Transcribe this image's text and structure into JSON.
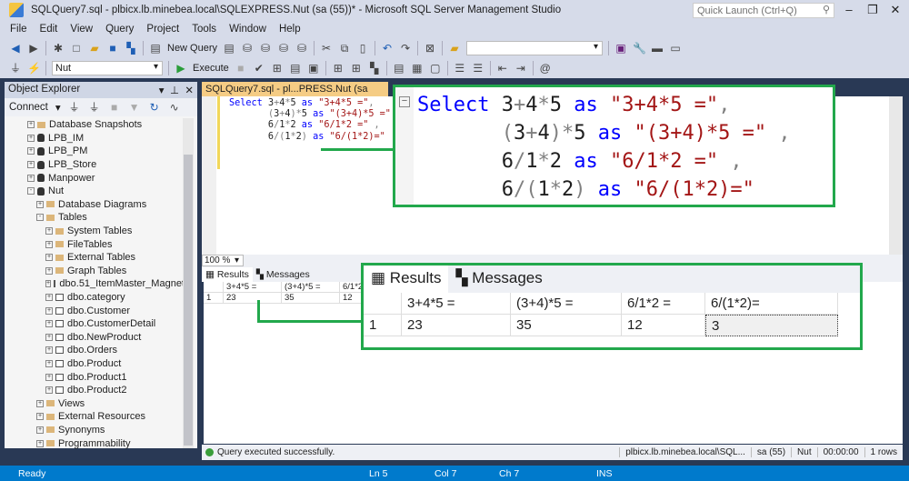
{
  "window": {
    "title": "SQLQuery7.sql - plbicx.lb.minebea.local\\SQLEXPRESS.Nut (sa (55))* - Microsoft SQL Server Management Studio",
    "quick_launch_placeholder": "Quick Launch (Ctrl+Q)"
  },
  "menu": [
    "File",
    "Edit",
    "View",
    "Query",
    "Project",
    "Tools",
    "Window",
    "Help"
  ],
  "toolbar": {
    "new_query": "New Query",
    "database": "Nut",
    "execute": "Execute"
  },
  "object_explorer": {
    "title": "Object Explorer",
    "connect": "Connect",
    "items": [
      {
        "label": "Database Snapshots",
        "level": 1,
        "icon": "folder",
        "exp": "+"
      },
      {
        "label": "LPB_IM",
        "level": 1,
        "icon": "db",
        "exp": "+"
      },
      {
        "label": "LPB_PM",
        "level": 1,
        "icon": "db",
        "exp": "+"
      },
      {
        "label": "LPB_Store",
        "level": 1,
        "icon": "db",
        "exp": "+"
      },
      {
        "label": "Manpower",
        "level": 1,
        "icon": "db",
        "exp": "+"
      },
      {
        "label": "Nut",
        "level": 1,
        "icon": "db",
        "exp": "-"
      },
      {
        "label": "Database Diagrams",
        "level": 2,
        "icon": "folder",
        "exp": "+"
      },
      {
        "label": "Tables",
        "level": 2,
        "icon": "folder",
        "exp": "-"
      },
      {
        "label": "System Tables",
        "level": 3,
        "icon": "folder",
        "exp": "+"
      },
      {
        "label": "FileTables",
        "level": 3,
        "icon": "folder",
        "exp": "+"
      },
      {
        "label": "External Tables",
        "level": 3,
        "icon": "folder",
        "exp": "+"
      },
      {
        "label": "Graph Tables",
        "level": 3,
        "icon": "folder",
        "exp": "+"
      },
      {
        "label": "dbo.51_ItemMaster_Magnet",
        "level": 3,
        "icon": "table",
        "exp": "+"
      },
      {
        "label": "dbo.category",
        "level": 3,
        "icon": "table",
        "exp": "+"
      },
      {
        "label": "dbo.Customer",
        "level": 3,
        "icon": "table",
        "exp": "+"
      },
      {
        "label": "dbo.CustomerDetail",
        "level": 3,
        "icon": "table",
        "exp": "+"
      },
      {
        "label": "dbo.NewProduct",
        "level": 3,
        "icon": "table",
        "exp": "+"
      },
      {
        "label": "dbo.Orders",
        "level": 3,
        "icon": "table",
        "exp": "+"
      },
      {
        "label": "dbo.Product",
        "level": 3,
        "icon": "table",
        "exp": "+"
      },
      {
        "label": "dbo.Product1",
        "level": 3,
        "icon": "table",
        "exp": "+"
      },
      {
        "label": "dbo.Product2",
        "level": 3,
        "icon": "table",
        "exp": "+"
      },
      {
        "label": "Views",
        "level": 2,
        "icon": "folder",
        "exp": "+"
      },
      {
        "label": "External Resources",
        "level": 2,
        "icon": "folder",
        "exp": "+"
      },
      {
        "label": "Synonyms",
        "level": 2,
        "icon": "folder",
        "exp": "+"
      },
      {
        "label": "Programmability",
        "level": 2,
        "icon": "folder",
        "exp": "+"
      }
    ]
  },
  "editor": {
    "tab": "SQLQuery7.sql - pl...PRESS.Nut (sa (55))*",
    "zoom": "100 %",
    "lines": [
      [
        [
          "kw",
          "Select "
        ],
        [
          "",
          "3"
        ],
        [
          "op",
          "+"
        ],
        [
          "",
          "4"
        ],
        [
          "op",
          "*"
        ],
        [
          "",
          "5 "
        ],
        [
          "kw",
          "as "
        ],
        [
          "st",
          "\"3+4*5 =\""
        ],
        [
          "op",
          ","
        ]
      ],
      [
        [
          "",
          "       "
        ],
        [
          "op",
          "("
        ],
        [
          "",
          "3"
        ],
        [
          "op",
          "+"
        ],
        [
          "",
          "4"
        ],
        [
          "op",
          ")*"
        ],
        [
          "",
          "5 "
        ],
        [
          "kw",
          "as "
        ],
        [
          "st",
          "\"(3+4)*5 =\""
        ],
        [
          "op",
          " ,"
        ]
      ],
      [
        [
          "",
          "       6"
        ],
        [
          "op",
          "/"
        ],
        [
          "",
          "1"
        ],
        [
          "op",
          "*"
        ],
        [
          "",
          "2 "
        ],
        [
          "kw",
          "as "
        ],
        [
          "st",
          "\"6/1*2 =\""
        ],
        [
          "op",
          " ,"
        ]
      ],
      [
        [
          "",
          "       6"
        ],
        [
          "op",
          "/("
        ],
        [
          "",
          "1"
        ],
        [
          "op",
          "*"
        ],
        [
          "",
          "2"
        ],
        [
          "op",
          ") "
        ],
        [
          "kw",
          "as "
        ],
        [
          "st",
          "\"6/(1*2)=\""
        ]
      ]
    ]
  },
  "results": {
    "tabs": [
      "Results",
      "Messages"
    ],
    "columns": [
      "3+4*5 =",
      "(3+4)*5 =",
      "6/1*2 =",
      "6/(1*2)="
    ],
    "rows": [
      [
        "1",
        "23",
        "35",
        "12",
        "3"
      ]
    ]
  },
  "status": {
    "message": "Query executed successfully.",
    "server": "plbicx.lb.minebea.local\\SQL...",
    "user": "sa (55)",
    "db": "Nut",
    "time": "00:00:00",
    "rows": "1 rows"
  },
  "bottom": {
    "ready": "Ready",
    "ln": "Ln 5",
    "col": "Col 7",
    "ch": "Ch 7",
    "mode": "INS"
  },
  "colors": {
    "accent": "#007acc",
    "callout": "#22a84c",
    "tab": "#f5cc84"
  }
}
